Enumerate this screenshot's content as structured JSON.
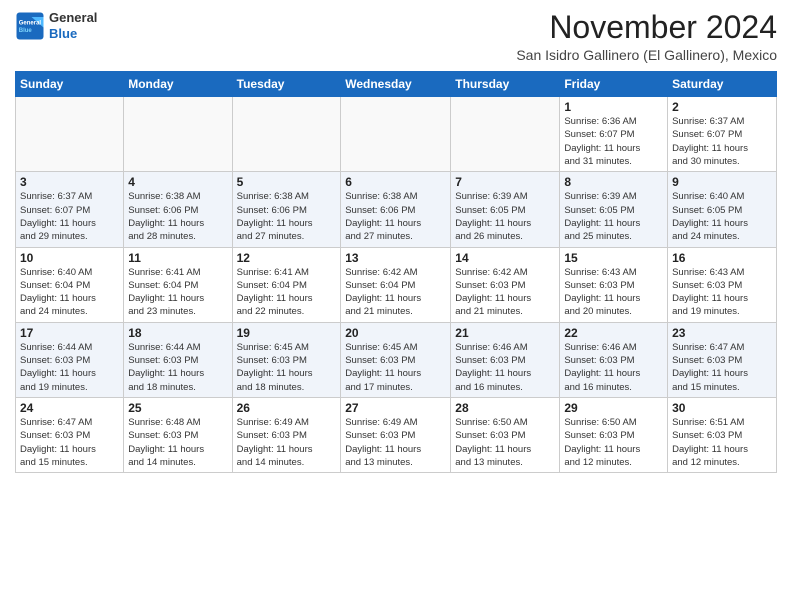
{
  "logo": {
    "general": "General",
    "blue": "Blue"
  },
  "header": {
    "month": "November 2024",
    "location": "San Isidro Gallinero (El Gallinero), Mexico"
  },
  "days_of_week": [
    "Sunday",
    "Monday",
    "Tuesday",
    "Wednesday",
    "Thursday",
    "Friday",
    "Saturday"
  ],
  "weeks": [
    [
      {
        "day": "",
        "info": ""
      },
      {
        "day": "",
        "info": ""
      },
      {
        "day": "",
        "info": ""
      },
      {
        "day": "",
        "info": ""
      },
      {
        "day": "",
        "info": ""
      },
      {
        "day": "1",
        "info": "Sunrise: 6:36 AM\nSunset: 6:07 PM\nDaylight: 11 hours\nand 31 minutes."
      },
      {
        "day": "2",
        "info": "Sunrise: 6:37 AM\nSunset: 6:07 PM\nDaylight: 11 hours\nand 30 minutes."
      }
    ],
    [
      {
        "day": "3",
        "info": "Sunrise: 6:37 AM\nSunset: 6:07 PM\nDaylight: 11 hours\nand 29 minutes."
      },
      {
        "day": "4",
        "info": "Sunrise: 6:38 AM\nSunset: 6:06 PM\nDaylight: 11 hours\nand 28 minutes."
      },
      {
        "day": "5",
        "info": "Sunrise: 6:38 AM\nSunset: 6:06 PM\nDaylight: 11 hours\nand 27 minutes."
      },
      {
        "day": "6",
        "info": "Sunrise: 6:38 AM\nSunset: 6:06 PM\nDaylight: 11 hours\nand 27 minutes."
      },
      {
        "day": "7",
        "info": "Sunrise: 6:39 AM\nSunset: 6:05 PM\nDaylight: 11 hours\nand 26 minutes."
      },
      {
        "day": "8",
        "info": "Sunrise: 6:39 AM\nSunset: 6:05 PM\nDaylight: 11 hours\nand 25 minutes."
      },
      {
        "day": "9",
        "info": "Sunrise: 6:40 AM\nSunset: 6:05 PM\nDaylight: 11 hours\nand 24 minutes."
      }
    ],
    [
      {
        "day": "10",
        "info": "Sunrise: 6:40 AM\nSunset: 6:04 PM\nDaylight: 11 hours\nand 24 minutes."
      },
      {
        "day": "11",
        "info": "Sunrise: 6:41 AM\nSunset: 6:04 PM\nDaylight: 11 hours\nand 23 minutes."
      },
      {
        "day": "12",
        "info": "Sunrise: 6:41 AM\nSunset: 6:04 PM\nDaylight: 11 hours\nand 22 minutes."
      },
      {
        "day": "13",
        "info": "Sunrise: 6:42 AM\nSunset: 6:04 PM\nDaylight: 11 hours\nand 21 minutes."
      },
      {
        "day": "14",
        "info": "Sunrise: 6:42 AM\nSunset: 6:03 PM\nDaylight: 11 hours\nand 21 minutes."
      },
      {
        "day": "15",
        "info": "Sunrise: 6:43 AM\nSunset: 6:03 PM\nDaylight: 11 hours\nand 20 minutes."
      },
      {
        "day": "16",
        "info": "Sunrise: 6:43 AM\nSunset: 6:03 PM\nDaylight: 11 hours\nand 19 minutes."
      }
    ],
    [
      {
        "day": "17",
        "info": "Sunrise: 6:44 AM\nSunset: 6:03 PM\nDaylight: 11 hours\nand 19 minutes."
      },
      {
        "day": "18",
        "info": "Sunrise: 6:44 AM\nSunset: 6:03 PM\nDaylight: 11 hours\nand 18 minutes."
      },
      {
        "day": "19",
        "info": "Sunrise: 6:45 AM\nSunset: 6:03 PM\nDaylight: 11 hours\nand 18 minutes."
      },
      {
        "day": "20",
        "info": "Sunrise: 6:45 AM\nSunset: 6:03 PM\nDaylight: 11 hours\nand 17 minutes."
      },
      {
        "day": "21",
        "info": "Sunrise: 6:46 AM\nSunset: 6:03 PM\nDaylight: 11 hours\nand 16 minutes."
      },
      {
        "day": "22",
        "info": "Sunrise: 6:46 AM\nSunset: 6:03 PM\nDaylight: 11 hours\nand 16 minutes."
      },
      {
        "day": "23",
        "info": "Sunrise: 6:47 AM\nSunset: 6:03 PM\nDaylight: 11 hours\nand 15 minutes."
      }
    ],
    [
      {
        "day": "24",
        "info": "Sunrise: 6:47 AM\nSunset: 6:03 PM\nDaylight: 11 hours\nand 15 minutes."
      },
      {
        "day": "25",
        "info": "Sunrise: 6:48 AM\nSunset: 6:03 PM\nDaylight: 11 hours\nand 14 minutes."
      },
      {
        "day": "26",
        "info": "Sunrise: 6:49 AM\nSunset: 6:03 PM\nDaylight: 11 hours\nand 14 minutes."
      },
      {
        "day": "27",
        "info": "Sunrise: 6:49 AM\nSunset: 6:03 PM\nDaylight: 11 hours\nand 13 minutes."
      },
      {
        "day": "28",
        "info": "Sunrise: 6:50 AM\nSunset: 6:03 PM\nDaylight: 11 hours\nand 13 minutes."
      },
      {
        "day": "29",
        "info": "Sunrise: 6:50 AM\nSunset: 6:03 PM\nDaylight: 11 hours\nand 12 minutes."
      },
      {
        "day": "30",
        "info": "Sunrise: 6:51 AM\nSunset: 6:03 PM\nDaylight: 11 hours\nand 12 minutes."
      }
    ]
  ]
}
